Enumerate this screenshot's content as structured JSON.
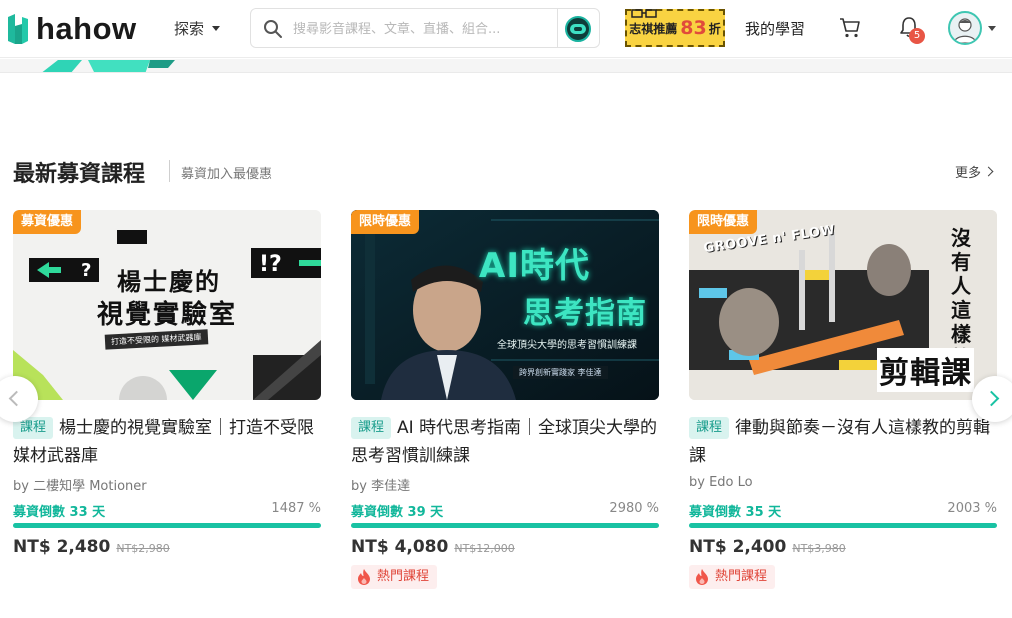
{
  "header": {
    "logo_text": "hahow",
    "explore_label": "探索",
    "search_placeholder": "搜尋影音課程、文章、直播、組合...",
    "promo": {
      "text": "志祺推薦",
      "number": "83",
      "unit": "折"
    },
    "my_learning": "我的學習",
    "notification_count": "5"
  },
  "section": {
    "title": "最新募資課程",
    "subtitle": "募資加入最優惠",
    "more": "更多"
  },
  "courses": [
    {
      "promo_tag": "募資優惠",
      "type": "課程",
      "title": "楊士慶的視覺實驗室｜打造不受限媒材武器庫",
      "author": "by 二樓知學 Motioner",
      "countdown": "募資倒數 33 天",
      "percent": "1487 %",
      "progress": 1.0,
      "price": "NT$ 2,480",
      "original_price": "NT$2,980",
      "thumb_text": {
        "line1": "楊士慶的",
        "line2": "視覺實驗室",
        "tagline": "打造不受限的 媒材武器庫"
      }
    },
    {
      "promo_tag": "限時優惠",
      "type": "課程",
      "title": "AI 時代思考指南｜全球頂尖大學的思考習慣訓練課",
      "author": "by 李佳達",
      "countdown": "募資倒數 39 天",
      "percent": "2980 %",
      "progress": 1.0,
      "price": "NT$ 4,080",
      "original_price": "NT$12,000",
      "hot": "熱門課程",
      "thumb_text": {
        "line1": "AI時代",
        "line2": "思考指南",
        "tagline": "全球頂尖大學的思考習慣訓練課",
        "byline": "跨界創新實踐家 李佳達"
      }
    },
    {
      "promo_tag": "限時優惠",
      "type": "課程",
      "title": "律動與節奏－沒有人這樣教的剪輯課",
      "author": "by Edo Lo",
      "countdown": "募資倒數 35 天",
      "percent": "2003 %",
      "progress": 1.0,
      "price": "NT$ 2,400",
      "original_price": "NT$3,980",
      "hot": "熱門課程",
      "thumb_text": {
        "brand": "GROOVE n' FLOW",
        "side": "沒有人這樣教的",
        "big": "剪輯課"
      }
    }
  ],
  "colors": {
    "accent": "#19c2a3",
    "promo_tag": "#f7941d",
    "hot": "#e0473b"
  }
}
